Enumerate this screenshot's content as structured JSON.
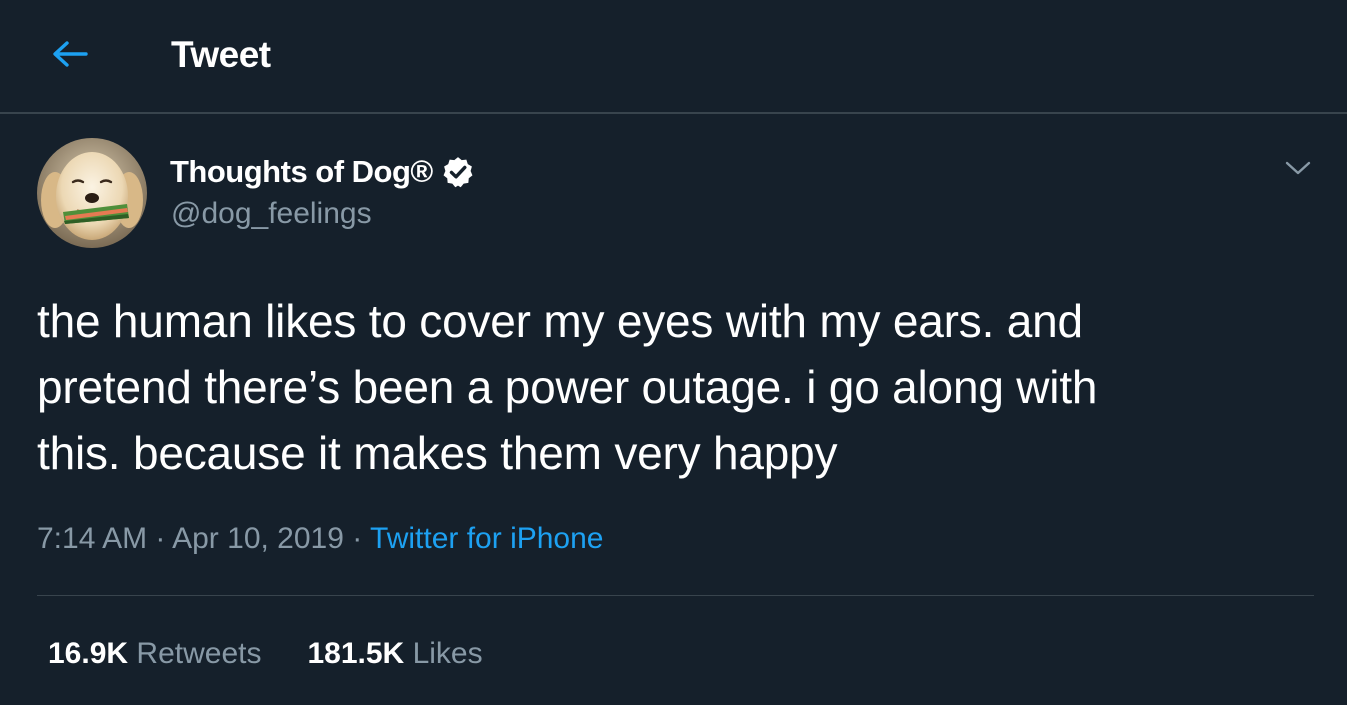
{
  "header": {
    "title": "Tweet"
  },
  "tweet": {
    "author": {
      "display_name": "Thoughts of Dog®",
      "handle": "@dog_feelings",
      "verified": true
    },
    "text_lines": [
      "the human likes to cover my eyes with my ears. and",
      "pretend there’s been a power outage. i go along with",
      "this. because it makes them very happy"
    ],
    "time": "7:14 AM",
    "separator": "·",
    "date": "Apr 10, 2019",
    "source": "Twitter for iPhone",
    "stats": {
      "retweets_count": "16.9K",
      "retweets_label": "Retweets",
      "likes_count": "181.5K",
      "likes_label": "Likes"
    }
  },
  "icons": {
    "back": "arrow-left-icon",
    "verified": "verified-badge-icon",
    "more": "chevron-down-icon"
  },
  "colors": {
    "background": "#15202b",
    "accent": "#1da1f2",
    "secondary_text": "#8899a6",
    "border": "#38444d"
  }
}
